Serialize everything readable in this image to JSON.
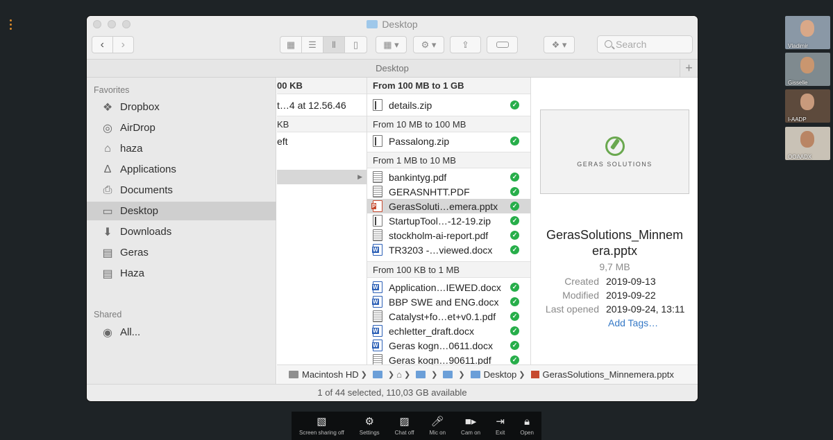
{
  "window": {
    "title": "Desktop",
    "path_header": "Desktop",
    "search_placeholder": "Search",
    "status": "1 of 44 selected, 110,03 GB available"
  },
  "sidebar": {
    "favorites_label": "Favorites",
    "shared_label": "Shared",
    "items": [
      {
        "label": "Dropbox",
        "icon": "dropbox-icon"
      },
      {
        "label": "AirDrop",
        "icon": "airdrop-icon"
      },
      {
        "label": "haza",
        "icon": "home-icon"
      },
      {
        "label": "Applications",
        "icon": "applications-icon"
      },
      {
        "label": "Documents",
        "icon": "documents-icon"
      },
      {
        "label": "Desktop",
        "icon": "desktop-icon",
        "selected": true
      },
      {
        "label": "Downloads",
        "icon": "downloads-icon"
      },
      {
        "label": "Geras",
        "icon": "folder-icon"
      },
      {
        "label": "Haza",
        "icon": "folder-icon"
      }
    ],
    "shared_items": [
      {
        "label": "All...",
        "icon": "network-icon"
      }
    ]
  },
  "column1": {
    "rows": [
      "00 KB",
      "t…4 at 12.56.46",
      "KB",
      "eft"
    ]
  },
  "column2": {
    "groups": [
      {
        "label": "From 100 MB to 1 GB",
        "files": [
          {
            "name": "details.zip",
            "type": "zip"
          }
        ]
      },
      {
        "label": "From 10 MB to 100 MB",
        "files": [
          {
            "name": "Passalong.zip",
            "type": "zip"
          }
        ]
      },
      {
        "label": "From 1 MB to 10 MB",
        "files": [
          {
            "name": "bankintyg.pdf",
            "type": "pdf"
          },
          {
            "name": "GERASNHTT.PDF",
            "type": "pdf"
          },
          {
            "name": "GerasSoluti…emera.pptx",
            "type": "ppt",
            "selected": true
          },
          {
            "name": "StartupTool…-12-19.zip",
            "type": "zip"
          },
          {
            "name": "stockholm-ai-report.pdf",
            "type": "pdf"
          },
          {
            "name": "TR3203 -…viewed.docx",
            "type": "doc"
          }
        ]
      },
      {
        "label": "From 100 KB to 1 MB",
        "files": [
          {
            "name": "Application…IEWED.docx",
            "type": "doc"
          },
          {
            "name": "BBP SWE and ENG.docx",
            "type": "doc"
          },
          {
            "name": "Catalyst+fo…et+v0.1.pdf",
            "type": "pdf"
          },
          {
            "name": "echletter_draft.docx",
            "type": "doc"
          },
          {
            "name": "Geras kogn…0611.docx",
            "type": "doc"
          },
          {
            "name": "Geras kogn…90611.pdf",
            "type": "pdf"
          }
        ]
      }
    ]
  },
  "preview": {
    "logo_text": "GERAS SOLUTIONS",
    "name_line1": "GerasSolutions_Minnem",
    "name_line2": "era.pptx",
    "size": "9,7 MB",
    "meta": [
      {
        "key": "Created",
        "value": "2019-09-13"
      },
      {
        "key": "Modified",
        "value": "2019-09-22"
      },
      {
        "key": "Last opened",
        "value": "2019-09-24, 13:11"
      }
    ],
    "add_tags": "Add Tags…"
  },
  "pathbar": {
    "disk": "Macintosh HD",
    "desktop": "Desktop",
    "file": "GerasSolutions_Minnemera.pptx"
  },
  "participants": [
    {
      "name": "Vladimir",
      "bg": "#8a98a6"
    },
    {
      "name": "Gisselle",
      "bg": "#7f8a8f"
    },
    {
      "name": "I-AADP",
      "bg": "#5d4a3c"
    },
    {
      "name": "OOAADX",
      "bg": "#c9c2b6"
    }
  ],
  "controls": [
    {
      "label": "Screen sharing off",
      "icon": "screen-share-off-icon"
    },
    {
      "label": "Settings",
      "icon": "settings-icon"
    },
    {
      "label": "Chat off",
      "icon": "chat-off-icon"
    },
    {
      "label": "Mic on",
      "icon": "mic-icon"
    },
    {
      "label": "Cam on",
      "icon": "camera-icon"
    },
    {
      "label": "Exit",
      "icon": "exit-icon"
    },
    {
      "label": "Open",
      "icon": "lock-icon"
    }
  ],
  "colors": {
    "accent": "#3478c6",
    "status_ok": "#27ae4a",
    "selected_row": "#d7d7d7"
  }
}
